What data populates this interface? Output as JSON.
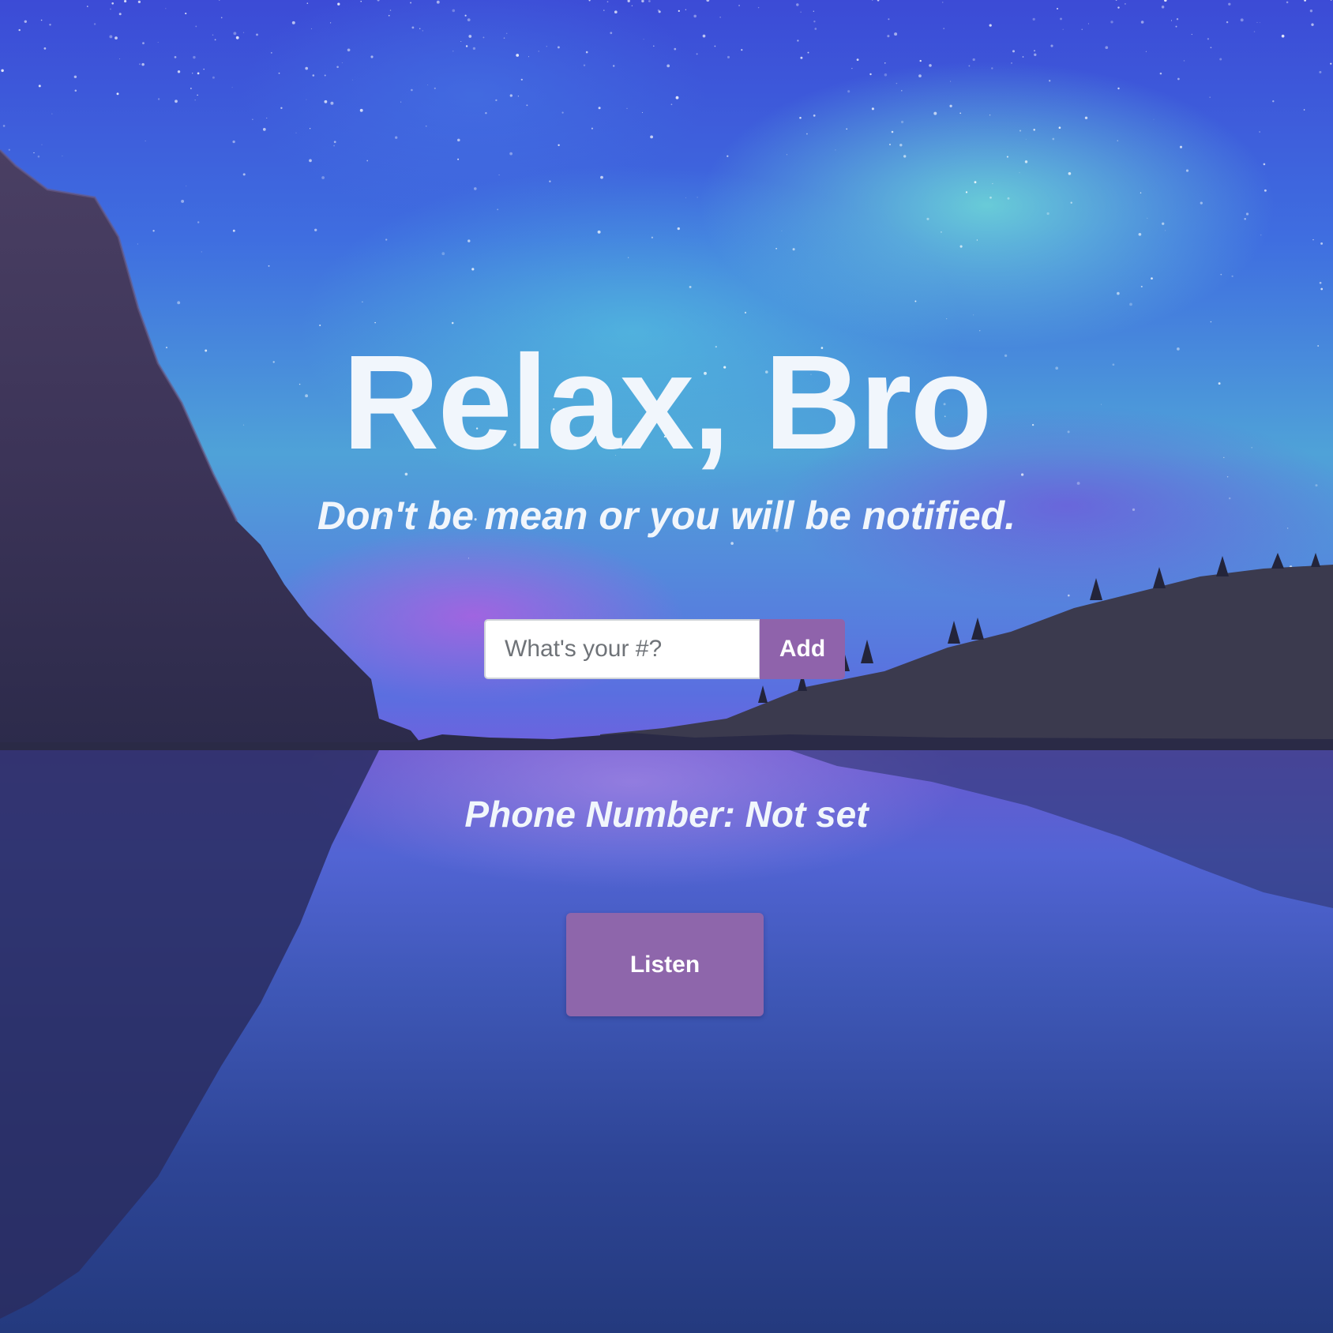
{
  "hero": {
    "title": "Relax, Bro",
    "subtitle": "Don't be mean or you will be notified."
  },
  "phone_form": {
    "placeholder": "What's your #?",
    "value": "",
    "add_label": "Add"
  },
  "status": {
    "phone_number_text": "Phone Number: Not set"
  },
  "actions": {
    "listen_label": "Listen"
  },
  "theme": {
    "button_color": "#8f63ab",
    "text_color": "#f1f6fc",
    "background_image": "aurora-over-mountain-lake"
  }
}
